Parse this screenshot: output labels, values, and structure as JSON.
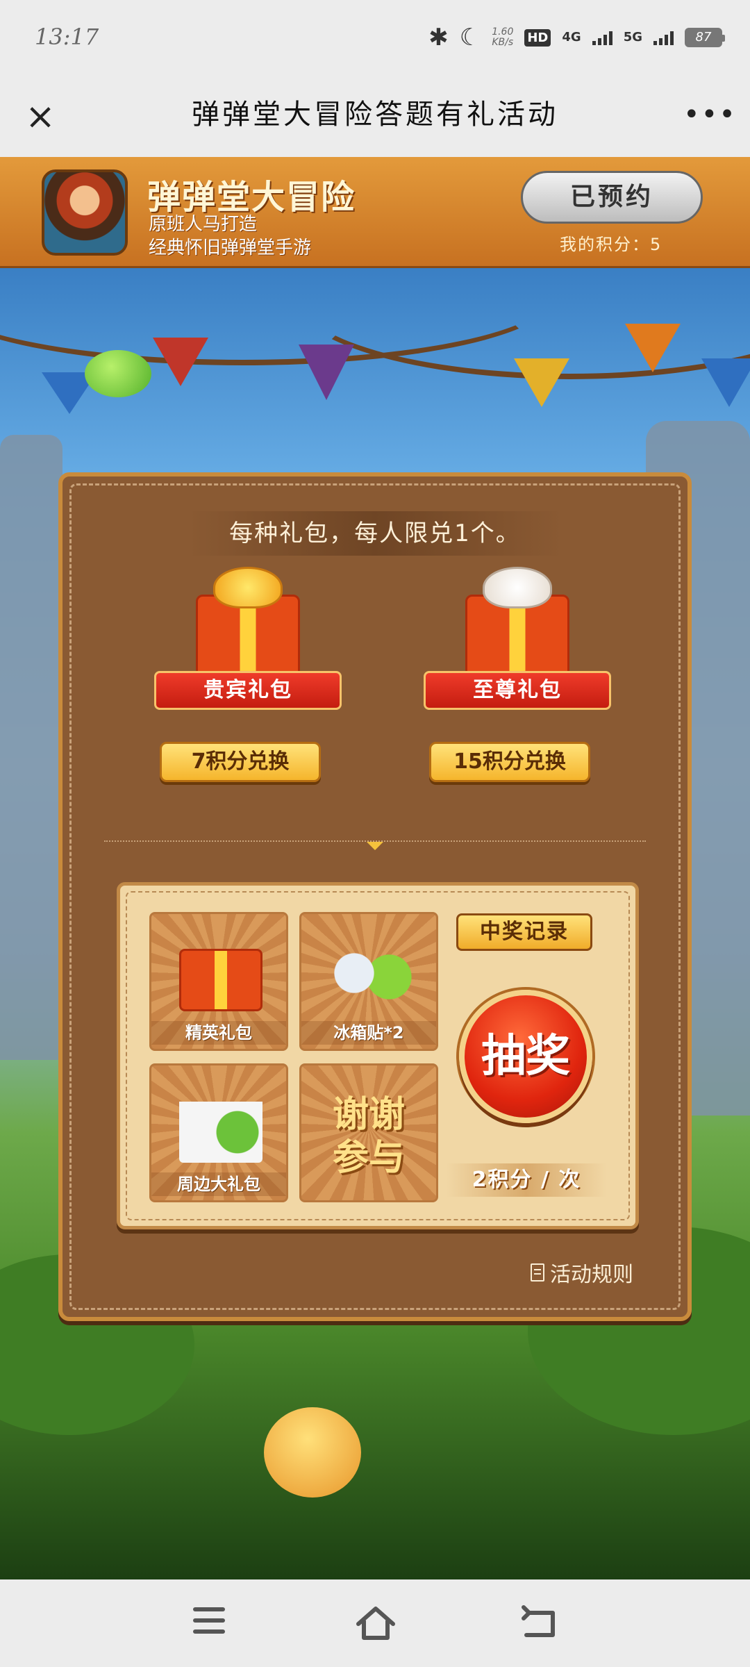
{
  "status_bar": {
    "time": "13:17",
    "net_speed_value": "1.60",
    "net_speed_unit": "KB/s",
    "hd_label": "HD",
    "sim1_network": "4G",
    "sim2_network": "5G",
    "battery": "87"
  },
  "title_bar": {
    "title": "弹弹堂大冒险答题有礼活动",
    "close_icon": "×",
    "more_icon": "•••"
  },
  "banner": {
    "game_name": "弹弹堂大冒险",
    "desc_line1": "原班人马打造",
    "desc_line2": "经典怀旧弹弹堂手游",
    "reserve_label": "已预约",
    "points_label": "我的积分：5"
  },
  "exchange": {
    "notice": "每种礼包，每人限兑1个。",
    "gifts": [
      {
        "name": "贵宾礼包",
        "button": "7积分兑换"
      },
      {
        "name": "至尊礼包",
        "button": "15积分兑换"
      }
    ]
  },
  "lottery": {
    "prizes": [
      {
        "label": "精英礼包"
      },
      {
        "label": "冰箱贴*2"
      },
      {
        "label": "周边大礼包"
      },
      {
        "label": "谢谢\n参与"
      }
    ],
    "record_label": "中奖记录",
    "draw_label": "抽奖",
    "cost_label": "2积分 / 次"
  },
  "rules_label": "活动规则",
  "nav": {
    "menu": "menu-icon",
    "home": "home-icon",
    "back": "back-icon"
  },
  "colors": {
    "banner": "#d5852f",
    "board": "#8a5a33",
    "accent_yellow": "#f5b52c",
    "draw_red": "#e0250e"
  }
}
